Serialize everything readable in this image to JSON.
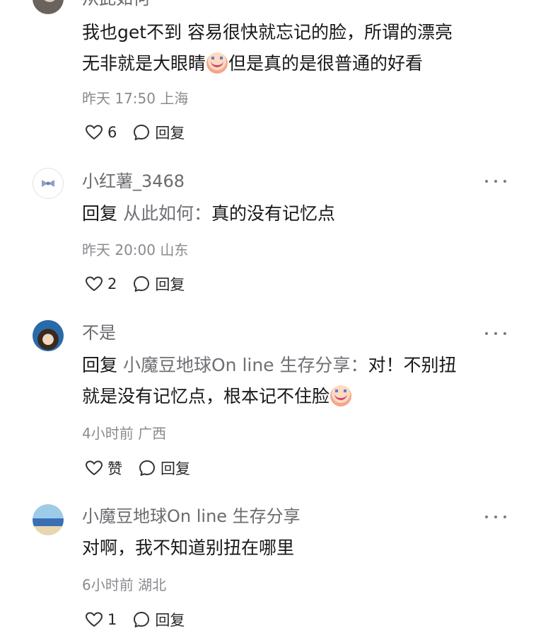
{
  "comments": [
    {
      "username": "从此如何",
      "text_1": "我也get不到 容易很快就忘记的脸，所谓的漂亮",
      "text_2a": "无非就是大眼睛",
      "text_2b": "但是真的是很普通的好看",
      "emoji": "crying-laughing-emoji",
      "time": "昨天 17:50 上海",
      "likes": "6",
      "reply_label": "回复"
    },
    {
      "username": "小红薯_3468",
      "reply_kw": "回复",
      "reply_target": "从此如何：",
      "text": "真的没有记忆点",
      "time": "昨天 20:00 山东",
      "likes": "2",
      "reply_label": "回复"
    },
    {
      "username": "不是",
      "reply_kw": "回复",
      "reply_target": "小魔豆地球On line 生存分享：",
      "text_1": "对！不别扭",
      "text_2": "就是没有记忆点，根本记不住脸",
      "emoji": "crying-emoji",
      "time": "4小时前 广西",
      "likes": "赞",
      "reply_label": "回复"
    },
    {
      "username": "小魔豆地球On line 生存分享",
      "text": "对啊，我不知道别扭在哪里",
      "time": "6小时前 湖北",
      "likes": "1",
      "reply_label": "回复"
    }
  ],
  "colors": {
    "muted_text": "#8a8a90",
    "username": "#6b6b70",
    "body_text": "#18181b",
    "background": "#ffffff"
  },
  "icons": [
    "heart-icon",
    "comment-bubble-icon",
    "more-dots-icon"
  ]
}
